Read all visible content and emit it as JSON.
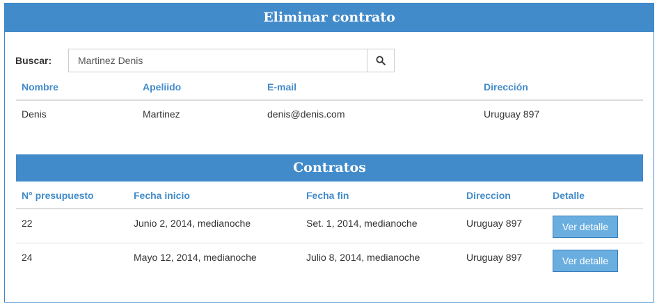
{
  "header": {
    "title": "Eliminar contrato"
  },
  "search": {
    "label": "Buscar:",
    "value": "Martinez Denis",
    "icon": "search-icon"
  },
  "client_table": {
    "columns": [
      "Nombre",
      "Apeliido",
      "E-mail",
      "Dirección"
    ],
    "rows": [
      [
        "Denis",
        "Martinez",
        "denis@denis.com",
        "Uruguay 897"
      ]
    ]
  },
  "contracts": {
    "title": "Contratos",
    "columns": [
      "N° presupuesto",
      "Fecha inicio",
      "Fecha fin",
      "Direccion",
      "Detalle"
    ],
    "rows": [
      {
        "number": "22",
        "start": "Junio 2, 2014, medianoche",
        "end": "Set. 1, 2014, medianoche",
        "address": "Uruguay 897",
        "button": "Ver detalle"
      },
      {
        "number": "24",
        "start": "Mayo 12, 2014, medianoche",
        "end": "Julio 8, 2014, medianoche",
        "address": "Uruguay 897",
        "button": "Ver detalle"
      }
    ]
  },
  "colors": {
    "accent": "#428bca",
    "button": "#6aaee0"
  }
}
